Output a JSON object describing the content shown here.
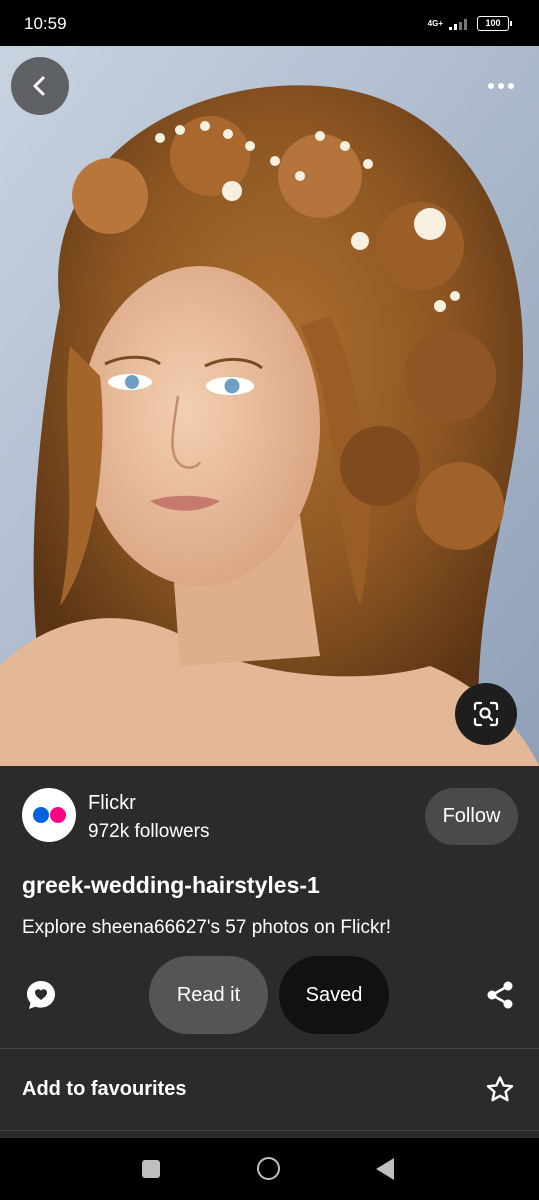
{
  "status_bar": {
    "time": "10:59",
    "network": "4G+",
    "battery": "100"
  },
  "pin": {
    "image_description_icon": "photo",
    "source": {
      "name": "Flickr",
      "followers": "972k followers",
      "follow_label": "Follow"
    },
    "title": "greek-wedding-hairstyles-1",
    "description": "Explore sheena66627's 57 photos on Flickr!"
  },
  "actions": {
    "read_label": "Read it",
    "saved_label": "Saved"
  },
  "favourites": {
    "label": "Add to favourites"
  },
  "icons": {
    "back": "back-arrow-icon",
    "more": "more-dots-icon",
    "lens": "visual-search-icon",
    "comment": "comment-heart-icon",
    "share": "share-icon",
    "star": "star-icon"
  },
  "colors": {
    "background": "#2b2b2b",
    "follow_button": "#4a4a4a",
    "read_button": "#555555",
    "saved_button": "#111111",
    "flickr_blue": "#0063dc",
    "flickr_pink": "#ff0084"
  }
}
